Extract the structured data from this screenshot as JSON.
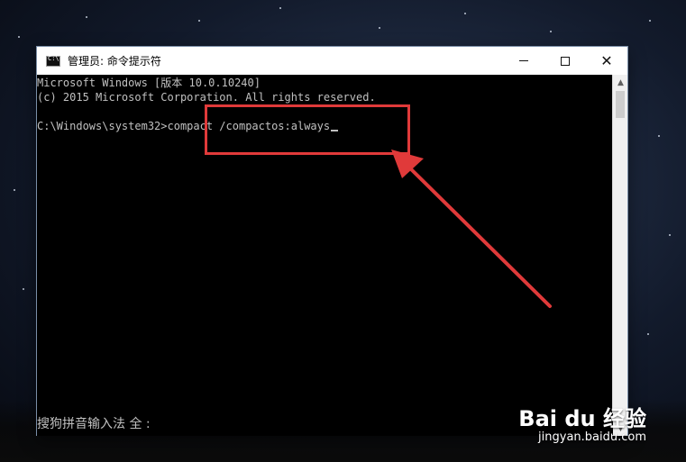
{
  "window": {
    "title": "管理员: 命令提示符",
    "controls": {
      "minimize_icon": "minimize-icon",
      "maximize_icon": "maximize-icon",
      "close_icon": "close-icon",
      "close_glyph": "✕"
    }
  },
  "console": {
    "lines": [
      "Microsoft Windows [版本 10.0.10240]",
      "(c) 2015 Microsoft Corporation. All rights reserved.",
      "",
      "C:\\Windows\\system32>compact /compactos:always"
    ]
  },
  "ime": {
    "status": "搜狗拼音输入法 全 :"
  },
  "annotation": {
    "highlight_color": "#e03a3a"
  },
  "watermark": {
    "logo": "Bai du 经验",
    "url": "jingyan.baidu.com"
  }
}
